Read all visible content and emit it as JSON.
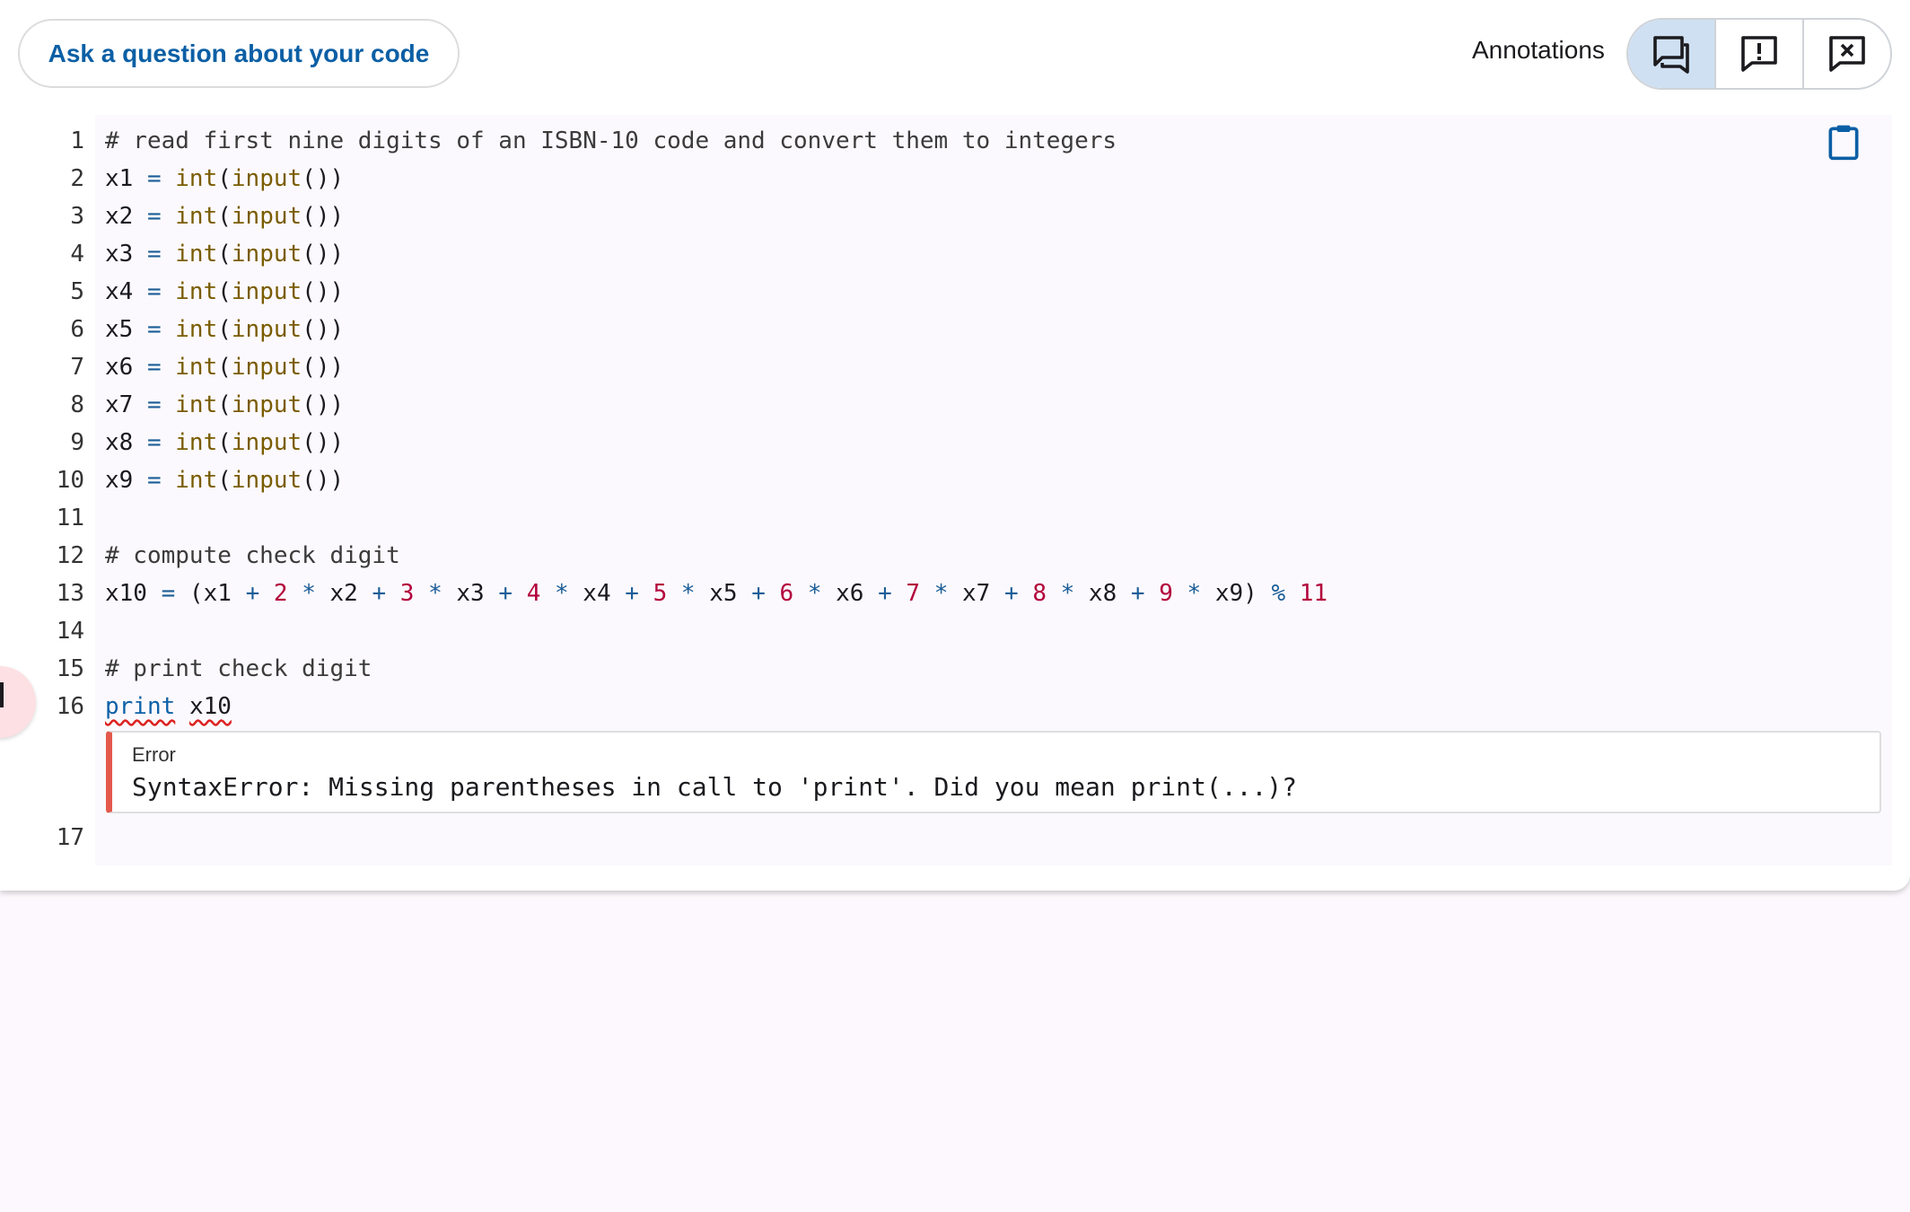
{
  "toolbar": {
    "ask_label": "Ask a question about your code",
    "annotations_label": "Annotations",
    "annotation_buttons": [
      {
        "icon": "comment-icon",
        "active": true
      },
      {
        "icon": "comment-alert-icon",
        "active": false
      },
      {
        "icon": "comment-remove-icon",
        "active": false
      }
    ]
  },
  "editor": {
    "copy_icon": "clipboard-icon",
    "lines": [
      {
        "n": "1",
        "text": "# read first nine digits of an ISBN-10 code and convert them to integers"
      },
      {
        "n": "2",
        "text": "x1 = int(input())"
      },
      {
        "n": "3",
        "text": "x2 = int(input())"
      },
      {
        "n": "4",
        "text": "x3 = int(input())"
      },
      {
        "n": "5",
        "text": "x4 = int(input())"
      },
      {
        "n": "6",
        "text": "x5 = int(input())"
      },
      {
        "n": "7",
        "text": "x6 = int(input())"
      },
      {
        "n": "8",
        "text": "x7 = int(input())"
      },
      {
        "n": "9",
        "text": "x8 = int(input())"
      },
      {
        "n": "10",
        "text": "x9 = int(input())"
      },
      {
        "n": "11",
        "text": ""
      },
      {
        "n": "12",
        "text": "# compute check digit"
      },
      {
        "n": "13",
        "text": "x10 = (x1 + 2 * x2 + 3 * x3 + 4 * x4 + 5 * x5 + 6 * x6 + 7 * x7 + 8 * x8 + 9 * x9) % 11"
      },
      {
        "n": "14",
        "text": ""
      },
      {
        "n": "15",
        "text": "# print check digit"
      },
      {
        "n": "16",
        "text": "print x10"
      },
      {
        "n": "17",
        "text": ""
      }
    ],
    "error": {
      "title": "Error",
      "message": "SyntaxError: Missing parentheses in call to 'print'. Did you mean print(...)?"
    }
  },
  "colors": {
    "accent": "#0b5fa5",
    "error_bar": "#e4584c",
    "active_button": "#cfe0f2"
  }
}
